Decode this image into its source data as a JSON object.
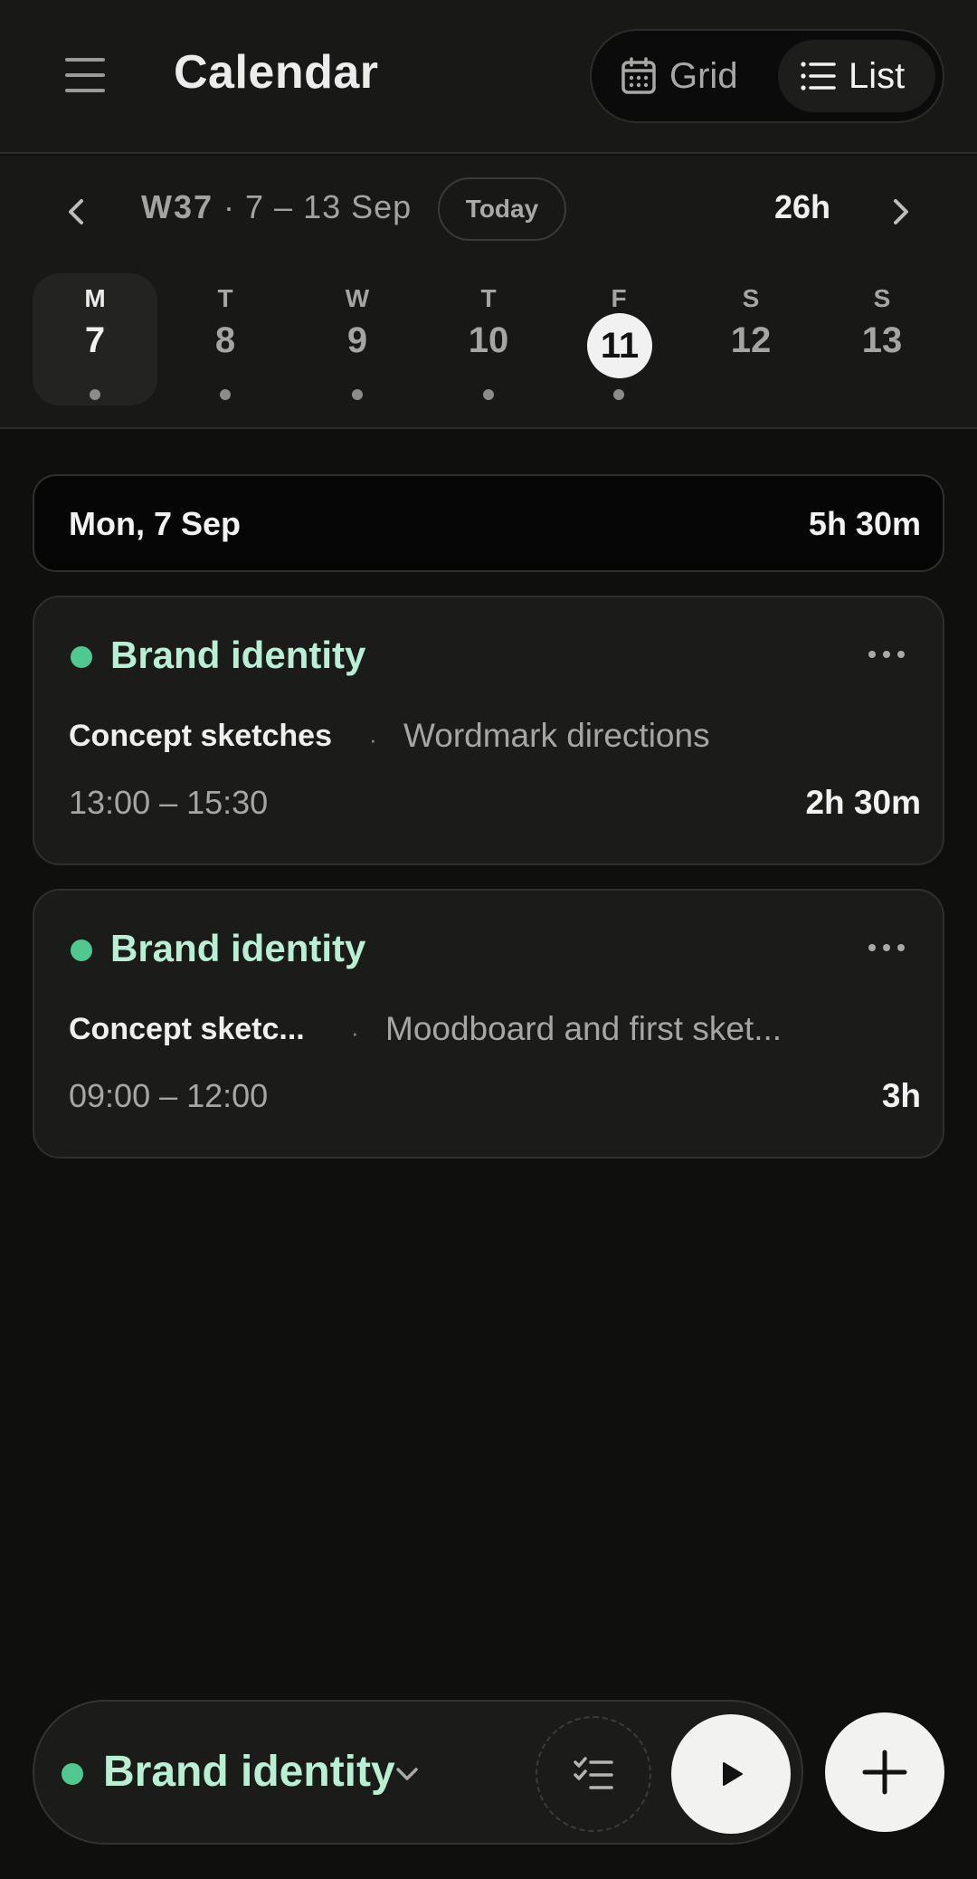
{
  "header": {
    "title": "Calendar",
    "view_toggle": {
      "grid_label": "Grid",
      "list_label": "List",
      "active": "List"
    }
  },
  "week": {
    "week_number": "W37",
    "range": "· 7 – 13 Sep",
    "today_label": "Today",
    "total": "26h",
    "days": [
      {
        "letter": "M",
        "number": "7"
      },
      {
        "letter": "T",
        "number": "8"
      },
      {
        "letter": "W",
        "number": "9"
      },
      {
        "letter": "T",
        "number": "10"
      },
      {
        "letter": "F",
        "number": "11"
      },
      {
        "letter": "S",
        "number": "12"
      },
      {
        "letter": "S",
        "number": "13"
      }
    ],
    "selected_day": "7",
    "today": "11"
  },
  "day_summary": {
    "title": "Mon, 7 Sep",
    "total": "5h 30m"
  },
  "entries": [
    {
      "project": "Brand identity",
      "task": "Concept sketches",
      "separator": "·",
      "description": "Wordmark directions",
      "time": "13:00 – 15:30",
      "duration": "2h 30m"
    },
    {
      "project": "Brand identity",
      "task": "Concept sketc...",
      "separator": "·",
      "description": "Moodboard and first sket...",
      "time": "09:00 – 12:00",
      "duration": "3h"
    }
  ],
  "timer": {
    "project": "Brand identity"
  },
  "colors": {
    "project_dot": "#4fc990",
    "project_text": "#b9efd2",
    "background": "#0f0f0e"
  },
  "icons": [
    "hamburger-menu-icon",
    "calendar-icon",
    "list-icon",
    "chevron-left-icon",
    "chevron-right-icon",
    "more-horizontal-icon",
    "chevron-down-icon",
    "checklist-icon",
    "play-icon",
    "plus-icon"
  ]
}
